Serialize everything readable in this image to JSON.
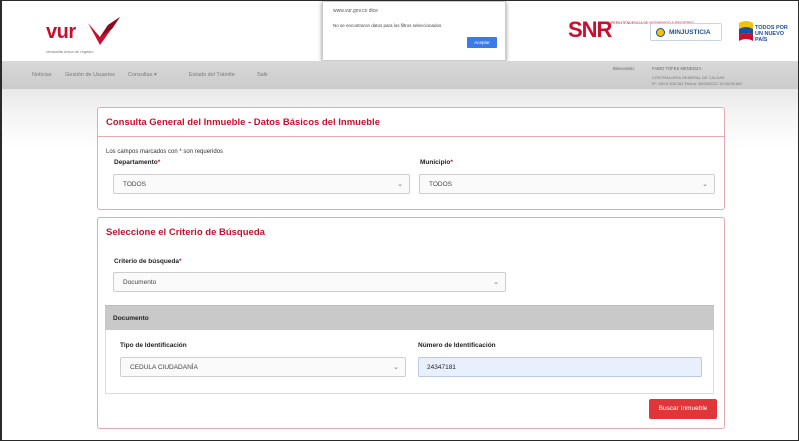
{
  "header": {
    "logo_text": "vur",
    "logo_tagline": "ventanilla única de registro",
    "popup": {
      "url": "www.vur.gov.co dice",
      "message": "No se encontraron datos para los filtros seleccionados",
      "button_label": "Aceptar"
    },
    "snr": {
      "letters": "SNR",
      "subtitle": "SUPERINTENDENCIA DE NOTARIADO & REGISTRO"
    },
    "minjusticia_label": "MINJUSTICIA",
    "todos_label": "TODOS POR UN NUEVO PAÍS"
  },
  "nav": {
    "items": [
      "Noticias",
      "Gestión de Usuarios",
      "Consultas ▾",
      "Estado del Trámite",
      "Salir"
    ],
    "user_label": "Bienvenido:",
    "user_name": "FABIO TOFES MENDOZA",
    "org_line1": "CONTRALORIA GENERAL DE CALDAS",
    "org_line2": "IP: 190.9.108.162  Fecha: 30/04/2021 10:45:05 AM"
  },
  "card1": {
    "title": "Consulta General del Inmueble - Datos Básicos del Inmueble",
    "required_note": "Los campos marcados con * son requeridos",
    "departamento_label": "Departamento",
    "departamento_value": "TODOS",
    "municipio_label": "Municipio",
    "municipio_value": "TODOS",
    "required_mark": "*"
  },
  "card2": {
    "title": "Seleccione el Criterio de Búsqueda",
    "criterio_label": "Criterio de búsqueda",
    "criterio_value": "Documento",
    "required_mark": "*",
    "documento_header": "Documento",
    "tipo_label": "Tipo de Identificación",
    "tipo_value": "CEDULA CIUDADANÍA",
    "numero_label": "Número de Identificación",
    "numero_value": "24347181",
    "search_button": "Buscar Inmueble"
  },
  "colors": {
    "brand_red": "#c8102e",
    "button_red": "#e0363a",
    "ministry_blue": "#1d4e9a"
  },
  "icons": [
    "vur-logo-mark",
    "chevron-down-icon",
    "minjusticia-seal-icon",
    "todos-flag-icon"
  ]
}
